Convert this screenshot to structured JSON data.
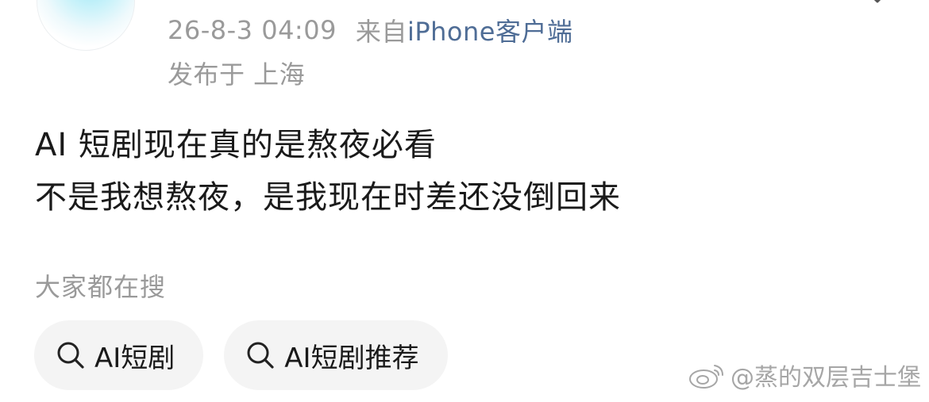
{
  "post": {
    "timestamp": "26-8-3 04:09",
    "source_prefix": "来自",
    "source_client": "iPhone客户端",
    "location": "发布于 上海",
    "lines": [
      "AI 短剧现在真的是熬夜必看",
      "不是我想熬夜，是我现在时差还没倒回来"
    ]
  },
  "search_section": {
    "title": "大家都在搜",
    "chips": [
      {
        "label": "AI短剧",
        "icon": "search-icon"
      },
      {
        "label": "AI短剧推荐",
        "icon": "search-icon"
      }
    ]
  },
  "watermark": {
    "text": "@蒸的双层吉士堡",
    "icon": "weibo-logo-icon"
  },
  "colors": {
    "meta_gray": "#9a9a9a",
    "client_link": "#4f6d96",
    "text": "#1a1a1a",
    "chip_bg": "#f4f4f4"
  }
}
